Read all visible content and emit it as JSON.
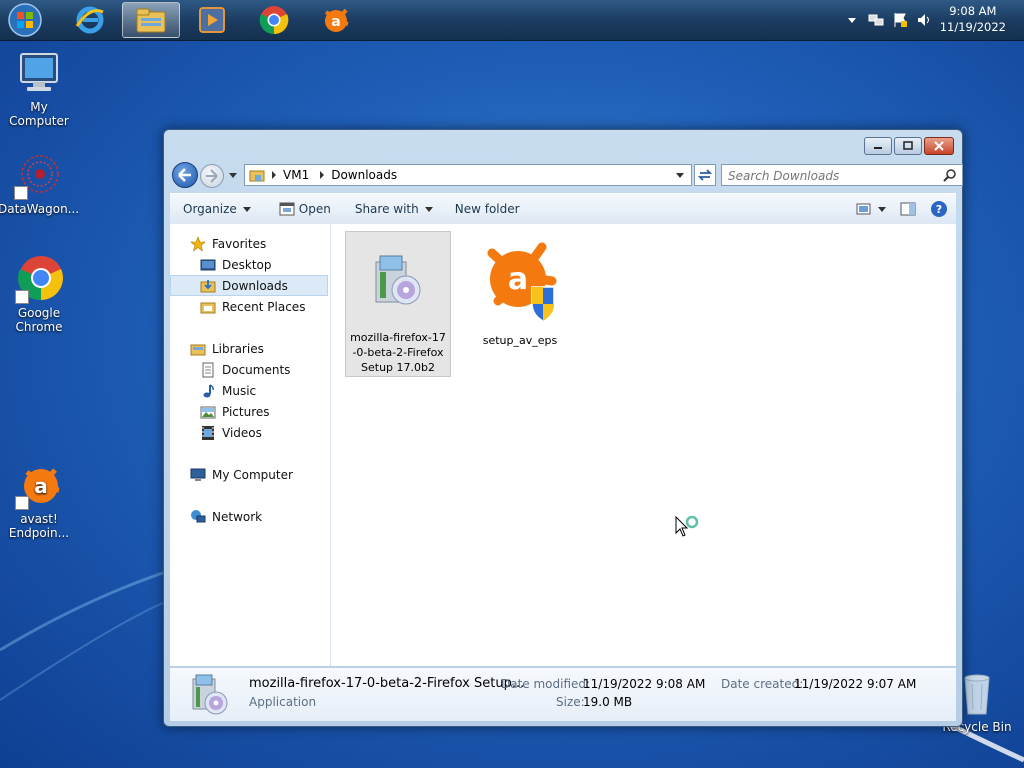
{
  "taskbar": {
    "clock_time": "9:08 AM",
    "clock_date": "11/19/2022",
    "pinned": [
      "internet-explorer-icon",
      "file-explorer-icon",
      "media-player-icon",
      "chrome-icon",
      "avast-icon"
    ]
  },
  "desktop": {
    "icons": [
      {
        "label": "My Computer"
      },
      {
        "label": "DataWagon..."
      },
      {
        "label": "Google Chrome"
      },
      {
        "label": "avast! Endpoin..."
      },
      {
        "label": "Recycle Bin"
      }
    ]
  },
  "window": {
    "breadcrumb": [
      "VM1",
      "Downloads"
    ],
    "search_placeholder": "Search Downloads",
    "toolbar": {
      "organize": "Organize",
      "open": "Open",
      "share_with": "Share with",
      "new_folder": "New folder"
    },
    "nav": {
      "favorites": "Favorites",
      "desktop": "Desktop",
      "downloads": "Downloads",
      "recent_places": "Recent Places",
      "libraries": "Libraries",
      "documents": "Documents",
      "music": "Music",
      "pictures": "Pictures",
      "videos": "Videos",
      "my_computer": "My Computer",
      "network": "Network"
    },
    "files": [
      {
        "name_line1": "mozilla-firefox-17",
        "name_line2": "-0-beta-2-Firefox",
        "name_line3": "Setup 17.0b2"
      },
      {
        "name_line1": "setup_av_eps"
      }
    ],
    "details": {
      "name": "mozilla-firefox-17-0-beta-2-Firefox Setup...",
      "type": "Application",
      "modified_label": "Date modified:",
      "modified_value": "11/19/2022 9:08 AM",
      "size_label": "Size:",
      "size_value": "19.0 MB",
      "created_label": "Date created:",
      "created_value": "11/19/2022 9:07 AM"
    }
  },
  "colors": {
    "desktop": "#1f5fb8",
    "taskbar": "#1c3d63",
    "avast_orange": "#f47a10",
    "selection": "#dceaf8"
  }
}
